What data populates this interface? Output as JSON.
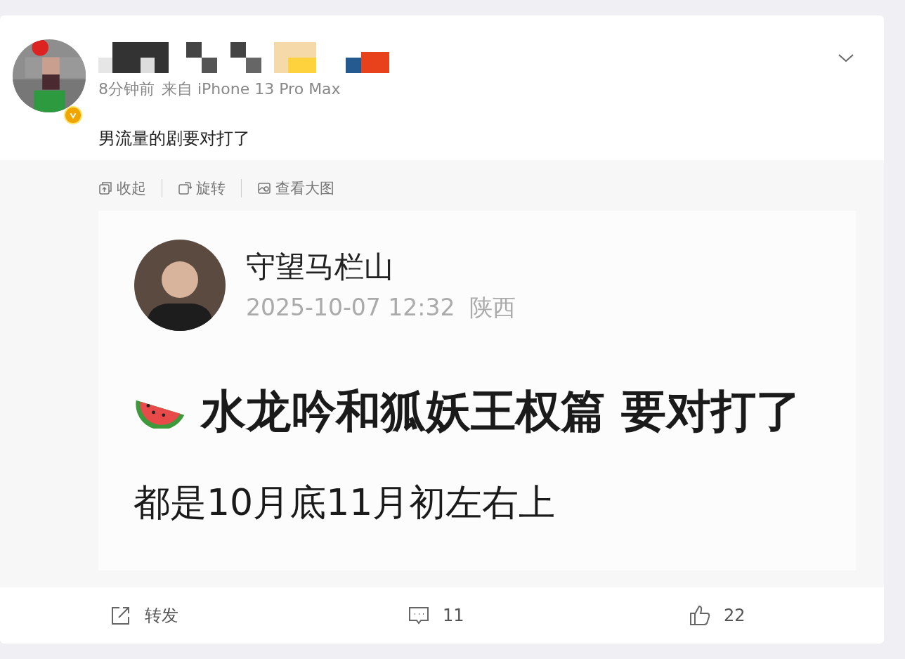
{
  "post": {
    "time": "8分钟前",
    "source": "来自 iPhone 13 Pro Max",
    "text": "男流量的剧要对打了",
    "verified": true
  },
  "image_toolbar": [
    {
      "label": "收起",
      "kind": "collapse"
    },
    {
      "label": "旋转",
      "kind": "rotate"
    },
    {
      "label": "查看大图",
      "kind": "enlarge"
    }
  ],
  "image": {
    "author": "守望马栏山",
    "meta": "2025-10-07 12:32  陕西",
    "headline": "水龙吟和狐妖王权篇 要对打了",
    "body": "都是10月底11月初左右上"
  },
  "actions": [
    {
      "kind": "repost",
      "label": "转发"
    },
    {
      "kind": "comment",
      "label": "11"
    },
    {
      "kind": "like",
      "label": "22"
    }
  ]
}
